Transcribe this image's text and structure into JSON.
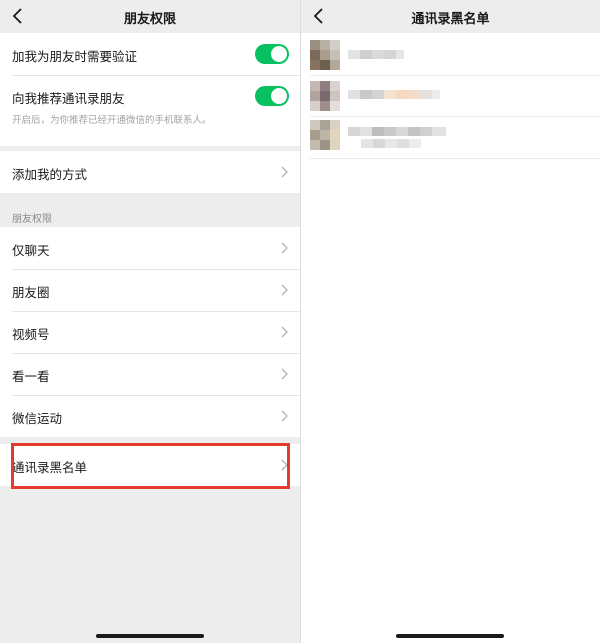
{
  "left_screen": {
    "title": "朋友权限",
    "verify_label": "加我为朋友时需要验证",
    "verify_on": true,
    "recommend_label": "向我推荐通讯录朋友",
    "recommend_on": true,
    "recommend_hint": "开启后，为你推荐已经开通微信的手机联系人。",
    "add_methods_label": "添加我的方式",
    "section_header": "朋友权限",
    "permissions": [
      "仅聊天",
      "朋友圈",
      "视频号",
      "看一看",
      "微信运动"
    ],
    "blacklist_label": "通讯录黑名单"
  },
  "right_screen": {
    "title": "通讯录黑名单",
    "contacts_note": "3 contacts, avatars and names pixelated"
  },
  "colors": {
    "toggle_on": "#07c160",
    "highlight_border": "#e53b2f",
    "background": "#ededed"
  },
  "icons": [
    "back-arrow-icon",
    "chevron-right-icon"
  ]
}
